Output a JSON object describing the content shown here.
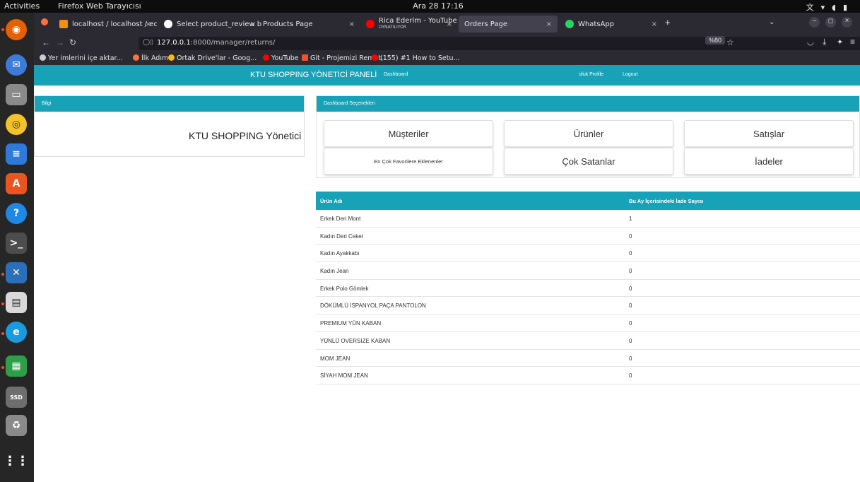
{
  "os": {
    "activities": "Activities",
    "app_name": "Firefox Web Tarayıcısı",
    "clock": "Ara 28  17:16"
  },
  "browser": {
    "tabs": [
      {
        "label": "localhost / localhost / ec",
        "active": false,
        "icon_color": "#f29111"
      },
      {
        "label": "Select product_review b",
        "active": false,
        "icon_color": "#ffffff"
      },
      {
        "label": "Products Page",
        "active": false,
        "icon_color": ""
      },
      {
        "label": "Rica Ederim - YouTube M",
        "sub": "OYNATILIYOR",
        "active": false,
        "icon_color": "#ff0000"
      },
      {
        "label": "Orders Page",
        "active": true,
        "icon_color": ""
      },
      {
        "label": "WhatsApp",
        "active": false,
        "icon_color": "#25d366"
      }
    ],
    "url_host": "127.0.0.1",
    "url_rest": ":8000/manager/returns/",
    "zoom": "%80",
    "bookmarks": [
      {
        "label": "Yer imlerini içe aktar...",
        "icon_color": "#cccccc"
      },
      {
        "label": "İlk Adım",
        "icon_color": "#ff7139"
      },
      {
        "label": "Ortak Drive'lar - Goog...",
        "icon_color": "#fbbc04"
      },
      {
        "label": "YouTube",
        "icon_color": "#ff0000"
      },
      {
        "label": "Git - Projemizi Remot...",
        "icon_color": "#f1502f"
      },
      {
        "label": "(155) #1 How to Setu...",
        "icon_color": "#ff0000"
      }
    ]
  },
  "page": {
    "accent_color": "#17a2b8",
    "header": {
      "brand": "KTU SHOPPING YÖNETİCİ PANELİ",
      "dashboard": "Dashboard",
      "user": "ufuk Profile",
      "logout": "Logout"
    },
    "info_card": {
      "title": "Bilgi",
      "text": "KTU SHOPPING Yönetici Paneline Hoşgeldiniz"
    },
    "options_card": {
      "title": "Dashboard Seçenekleri",
      "buttons": [
        "Müşteriler",
        "Ürünler",
        "Satışlar",
        "En Çok Favorilere Eklenenler",
        "Çok Satanlar",
        "İadeler"
      ]
    },
    "table": {
      "headers": [
        "Ürün Adı",
        "Bu Ay İçerisindeki İade Sayısı"
      ],
      "rows": [
        [
          "Erkek Deri Mont",
          "1"
        ],
        [
          "Kadın Deri Ceket",
          "0"
        ],
        [
          "Kadın Ayakkabı",
          "0"
        ],
        [
          "Kadın Jean",
          "0"
        ],
        [
          "Erkek Polo Gömlek",
          "0"
        ],
        [
          "DÖKÜMLÜ İSPANYOL PAÇA PANTOLON",
          "0"
        ],
        [
          "PREMIUM YÜN KABAN",
          "0"
        ],
        [
          "YÜNLÜ OVERSIZE KABAN",
          "0"
        ],
        [
          "MOM JEAN",
          "0"
        ],
        [
          "SİYAH MOM JEAN",
          "0"
        ]
      ]
    }
  }
}
